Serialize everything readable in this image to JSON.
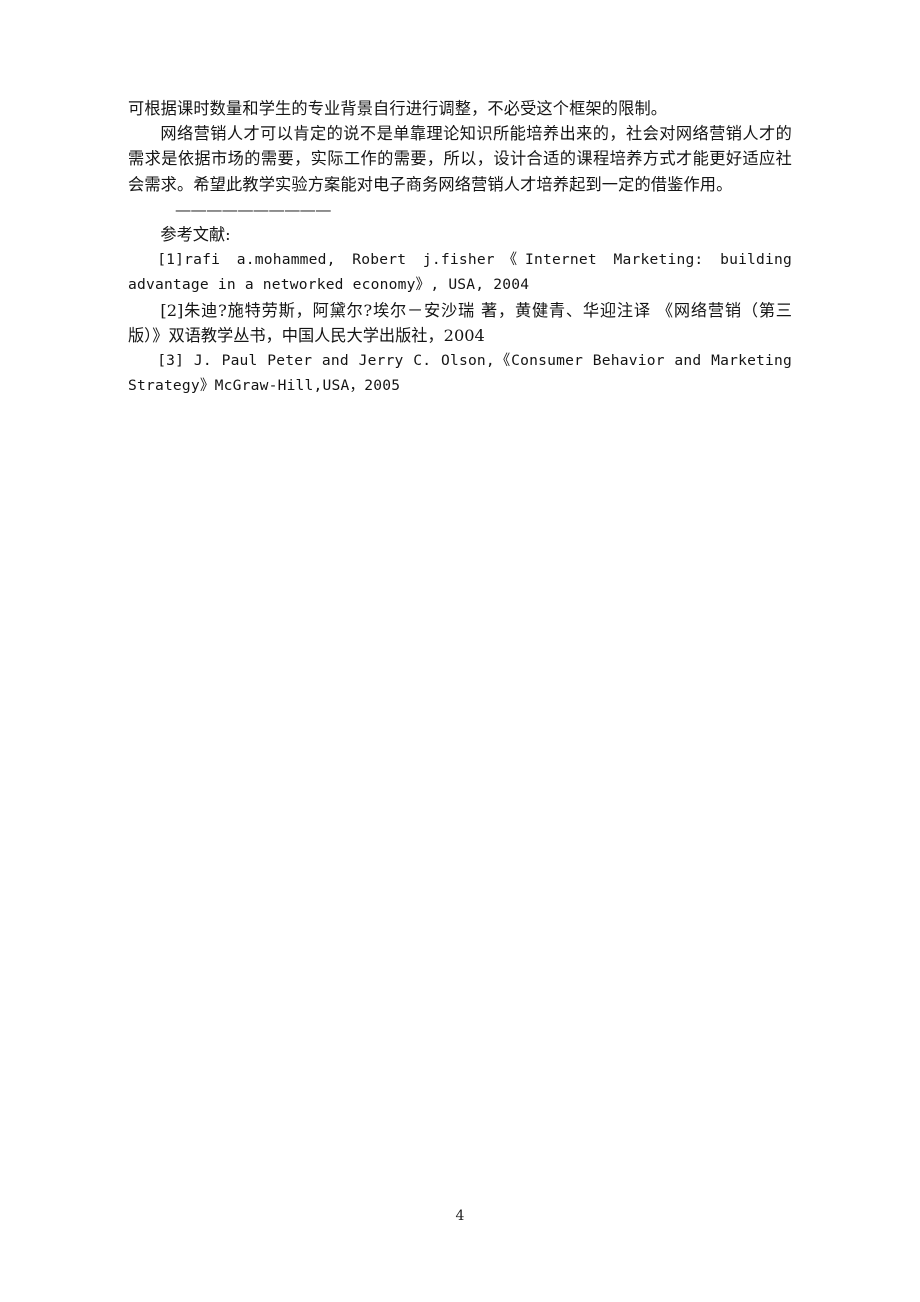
{
  "document": {
    "page_number": "4",
    "body_paragraphs": [
      {
        "id": "p1",
        "indent": false,
        "text": "可根据课时数量和学生的专业背景自行进行调整，不必受这个框架的限制。"
      },
      {
        "id": "p2",
        "indent": true,
        "text": "网络营销人才可以肯定的说不是单靠理论知识所能培养出来的，社会对网络营销人才的需求是依据市场的需要，实际工作的需要，所以，设计合适的课程培养方式才能更好适应社会需求。希望此教学实验方案能对电子商务网络营销人才培养起到一定的借鉴作用。"
      }
    ],
    "divider": "——————————",
    "references_heading": "参考文献:",
    "references": [
      {
        "id": "ref1",
        "script": "latin",
        "text": "[1]rafi a.mohammed, Robert j.fisher《Internet Marketing: building advantage in a networked economy》, USA, 2004"
      },
      {
        "id": "ref2",
        "script": "mixed",
        "text": "[2]朱迪?施特劳斯，阿黛尔?埃尔－安沙瑞 著，黄健青、华迎注译 《网络营销（第三版）》双语教学丛书，中国人民大学出版社，2004"
      },
      {
        "id": "ref3",
        "script": "latin",
        "text": "[3] J. Paul Peter and Jerry C. Olson,《Consumer Behavior and Marketing Strategy》McGraw-Hill,USA，2005"
      }
    ]
  }
}
